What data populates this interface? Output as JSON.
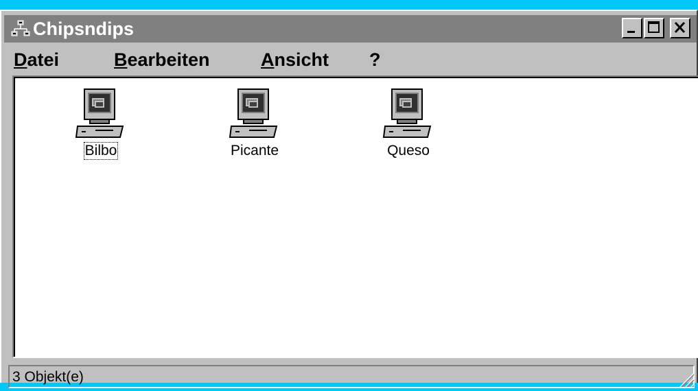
{
  "window": {
    "title": "Chipsndips",
    "icon": "network-neighborhood-icon"
  },
  "titlebar_buttons": [
    {
      "name": "minimize",
      "icon": "minimize-icon"
    },
    {
      "name": "maximize",
      "icon": "maximize-icon"
    },
    {
      "name": "close",
      "icon": "close-icon"
    }
  ],
  "menu": {
    "items": [
      "Datei",
      "Bearbeiten",
      "Ansicht",
      "?"
    ]
  },
  "items": [
    {
      "label": "Bilbo",
      "icon": "computer-icon",
      "selected": true
    },
    {
      "label": "Picante",
      "icon": "computer-icon",
      "selected": false
    },
    {
      "label": "Queso",
      "icon": "computer-icon",
      "selected": false
    }
  ],
  "status": {
    "text": "3 Objekt(e)"
  },
  "colors": {
    "desktop": "#00c8f8",
    "titlebar_inactive": "#808080",
    "face": "#c0c0c0"
  }
}
